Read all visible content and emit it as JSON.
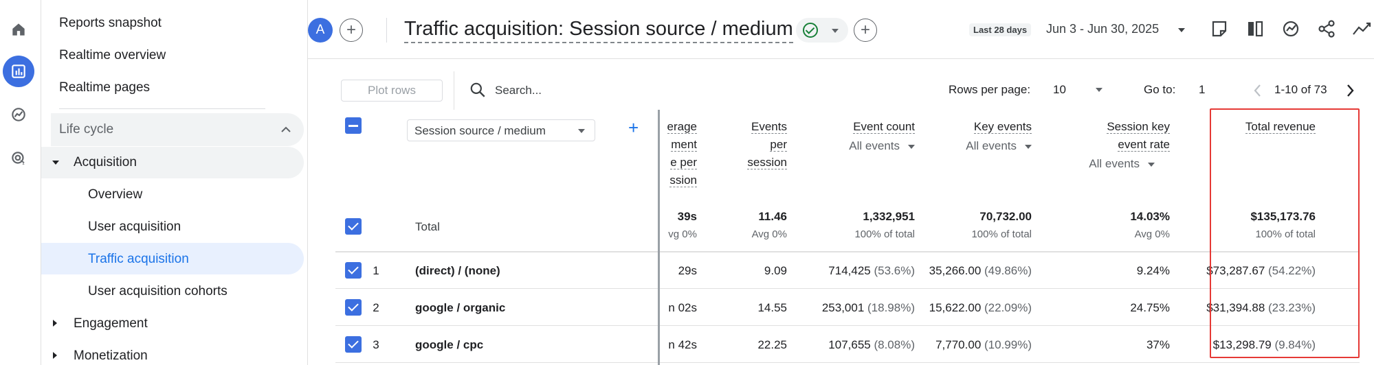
{
  "rail": {
    "items": [
      {
        "icon": "home-icon"
      },
      {
        "icon": "reports-icon",
        "active": true
      },
      {
        "icon": "explore-icon"
      },
      {
        "icon": "advertising-icon"
      }
    ]
  },
  "nav": {
    "top_items": [
      "Reports snapshot",
      "Realtime overview",
      "Realtime pages"
    ],
    "section_label": "Life cycle",
    "acquisition_label": "Acquisition",
    "acquisition_items": [
      "Overview",
      "User acquisition",
      "Traffic acquisition",
      "User acquisition cohorts"
    ],
    "active_item": "Traffic acquisition",
    "collapsed_items": [
      "Engagement",
      "Monetization"
    ]
  },
  "header": {
    "avatar_letter": "A",
    "title": "Traffic acquisition: Session source / medium",
    "date_chip": "Last 28 days",
    "date_range": "Jun 3 - Jun 30, 2025",
    "icons": [
      "annotation-icon",
      "compare-icon",
      "insights-icon",
      "share-icon",
      "trend-icon"
    ]
  },
  "toolbar": {
    "plot_rows": "Plot rows",
    "search_placeholder": "Search...",
    "rows_per_page_label": "Rows per page:",
    "rows_per_page": "10",
    "goto_label": "Go to:",
    "goto_value": "1",
    "page_info": "1-10 of 73"
  },
  "table": {
    "dimension": "Session source / medium",
    "partial_col_lines": [
      "erage",
      "ment",
      "e per",
      "ssion"
    ],
    "columns": [
      {
        "lines": [
          "Events",
          "per",
          "session"
        ],
        "sub": ""
      },
      {
        "lines": [
          "Event count"
        ],
        "sub": "All events"
      },
      {
        "lines": [
          "Key events"
        ],
        "sub": "All events"
      },
      {
        "lines": [
          "Session key",
          "event rate"
        ],
        "sub": "All events"
      },
      {
        "lines": [
          "Total revenue"
        ],
        "sub": ""
      }
    ],
    "total": {
      "label": "Total",
      "partial": {
        "value": "39s",
        "sub": "vg 0%"
      },
      "values": [
        {
          "value": "11.46",
          "sub": "Avg 0%"
        },
        {
          "value": "1,332,951",
          "sub": "100% of total"
        },
        {
          "value": "70,732.00",
          "sub": "100% of total"
        },
        {
          "value": "14.03%",
          "sub": "Avg 0%"
        },
        {
          "value": "$135,173.76",
          "sub": "100% of total"
        }
      ]
    },
    "rows": [
      {
        "num": "1",
        "name": "(direct) / (none)",
        "partial": "29s",
        "cells": [
          {
            "v": "9.09",
            "p": ""
          },
          {
            "v": "714,425",
            "p": "(53.6%)"
          },
          {
            "v": "35,266.00",
            "p": "(49.86%)"
          },
          {
            "v": "9.24%",
            "p": ""
          },
          {
            "v": "$73,287.67",
            "p": "(54.22%)"
          }
        ]
      },
      {
        "num": "2",
        "name": "google / organic",
        "partial": "n 02s",
        "cells": [
          {
            "v": "14.55",
            "p": ""
          },
          {
            "v": "253,001",
            "p": "(18.98%)"
          },
          {
            "v": "15,622.00",
            "p": "(22.09%)"
          },
          {
            "v": "24.75%",
            "p": ""
          },
          {
            "v": "$31,394.88",
            "p": "(23.23%)"
          }
        ]
      },
      {
        "num": "3",
        "name": "google / cpc",
        "partial": "n 42s",
        "cells": [
          {
            "v": "22.25",
            "p": ""
          },
          {
            "v": "107,655",
            "p": "(8.08%)"
          },
          {
            "v": "7,770.00",
            "p": "(10.99%)"
          },
          {
            "v": "37%",
            "p": ""
          },
          {
            "v": "$13,298.79",
            "p": "(9.84%)"
          }
        ]
      }
    ]
  },
  "colors": {
    "accent": "#3c6fe0",
    "highlight_border": "#e53935",
    "active_nav_bg": "#e8f0fe"
  }
}
